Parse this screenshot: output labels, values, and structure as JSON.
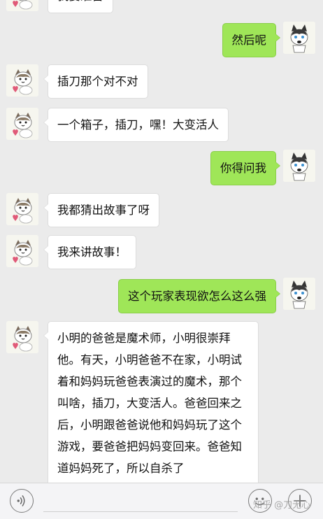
{
  "conversation": {
    "messages": [
      {
        "side": "left",
        "text": "我要准备",
        "avatar": "cat-avatar-icon"
      },
      {
        "side": "right",
        "text": "然后呢",
        "avatar": "husky-avatar-icon"
      },
      {
        "side": "left",
        "text": "插刀那个对不对",
        "avatar": "cat-avatar-icon"
      },
      {
        "side": "left",
        "text": "一个箱子，插刀，嘿！大变活人",
        "avatar": "cat-avatar-icon"
      },
      {
        "side": "right",
        "text": "你得问我",
        "avatar": "husky-avatar-icon"
      },
      {
        "side": "left",
        "text": "我都猜出故事了呀",
        "avatar": "cat-avatar-icon"
      },
      {
        "side": "left",
        "text": "我来讲故事！",
        "avatar": "cat-avatar-icon"
      },
      {
        "side": "right",
        "text": "这个玩家表现欲怎么这么强",
        "avatar": "husky-avatar-icon"
      },
      {
        "side": "left",
        "text": "小明的爸爸是魔术师，小明很崇拜他。有天，小明爸爸不在家，小明试着和妈妈玩爸爸表演过的魔术，那个叫啥，插刀，大变活人。爸爸回来之后，小明跟爸爸说他和妈妈玩了这个游戏，要爸爸把妈妈变回来。爸爸知道妈妈死了，所以自杀了",
        "avatar": "cat-avatar-icon"
      }
    ]
  },
  "input_bar": {
    "voice_icon": "voice-icon",
    "emoji_icon": "emoji-icon",
    "plus_icon": "plus-icon",
    "watermark": "知乎 @刀无心"
  },
  "colors": {
    "background": "#ebebeb",
    "bubble_left": "#ffffff",
    "bubble_right": "#9fe658"
  }
}
